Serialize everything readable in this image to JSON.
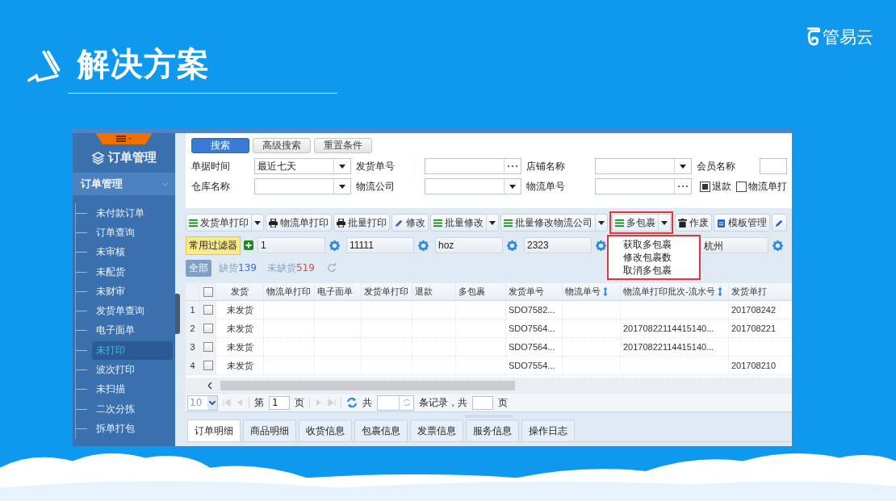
{
  "slide": {
    "title": "解决方案",
    "logo": "管易云"
  },
  "sidebar": {
    "title": "订单管理",
    "section": {
      "label": "订单管理",
      "expanded": true
    },
    "items": [
      {
        "label": "未付款订单",
        "selected": false
      },
      {
        "label": "订单查询",
        "selected": false
      },
      {
        "label": "未审核",
        "selected": false
      },
      {
        "label": "未配货",
        "selected": false
      },
      {
        "label": "未财审",
        "selected": false
      },
      {
        "label": "发货单查询",
        "selected": false
      },
      {
        "label": "电子面单",
        "selected": false
      },
      {
        "label": "未打印",
        "selected": true
      },
      {
        "label": "波次打印",
        "selected": false
      },
      {
        "label": "未扫描",
        "selected": false
      },
      {
        "label": "二次分拣",
        "selected": false
      },
      {
        "label": "拆单打包",
        "selected": false
      }
    ]
  },
  "search": {
    "buttons": [
      {
        "label": "搜索",
        "selected": true
      },
      {
        "label": "高级搜索",
        "selected": false
      },
      {
        "label": "重置条件",
        "selected": false
      }
    ],
    "fields": [
      {
        "label": "单据时间",
        "kind": "select",
        "value": "最近七天"
      },
      {
        "label": "发货单号",
        "kind": "picker"
      },
      {
        "label": "店铺名称",
        "kind": "select"
      },
      {
        "label": "会员名称",
        "kind": "text"
      },
      {
        "label": "仓库名称",
        "kind": "select"
      },
      {
        "label": "物流公司",
        "kind": "select"
      },
      {
        "label": "物流单号",
        "kind": "picker"
      }
    ],
    "checkboxes": [
      {
        "label": "退款",
        "checked": true
      },
      {
        "label": "物流单打",
        "checked": false
      }
    ]
  },
  "toolbar": {
    "buttons": [
      {
        "label": "发货单打印",
        "kind": "list",
        "split": true,
        "open": false
      },
      {
        "label": "物流单打印",
        "kind": "printer",
        "split": false,
        "open": false
      },
      {
        "label": "批量打印",
        "kind": "printer",
        "split": false,
        "open": false
      },
      {
        "label": "修改",
        "kind": "pencil",
        "split": false,
        "open": false
      },
      {
        "label": "批量修改",
        "kind": "list",
        "split": true,
        "open": false
      },
      {
        "label": "批量修改物流公司",
        "kind": "list",
        "split": true,
        "open": false
      },
      {
        "label": "多包裹",
        "kind": "list",
        "split": true,
        "open": true
      },
      {
        "label": "作废",
        "kind": "trash",
        "split": false,
        "open": false
      },
      {
        "label": "模板管理",
        "kind": "clipboard",
        "split": false,
        "open": false
      },
      {
        "kind": "pencil",
        "split": false,
        "open": false
      }
    ]
  },
  "menu": {
    "items": [
      "获取多包裹",
      "修改包裹数",
      "取消多包裹"
    ]
  },
  "filters": {
    "label": "常用过滤器",
    "inputs": [
      "1",
      "11111",
      "hoz",
      "2323",
      "杭州"
    ]
  },
  "status_tabs": [
    {
      "label": "全部",
      "selected": true
    },
    {
      "label": "缺货",
      "count": "139",
      "color": "#3a6fd0",
      "selected": false
    },
    {
      "label": "未缺货",
      "count": "519",
      "color": "#c0584a",
      "selected": false
    }
  ],
  "table": {
    "all_checked": false,
    "columns": [
      {
        "label": "发货"
      },
      {
        "label": "物流单打印"
      },
      {
        "label": "电子面单"
      },
      {
        "label": "发货单打印"
      },
      {
        "label": "退款"
      },
      {
        "label": "多包裹"
      },
      {
        "label": "发货单号"
      },
      {
        "label": "物流单号",
        "sortable": true
      },
      {
        "label": "物流单打印批次-流水号",
        "sortable": true
      },
      {
        "label": "发货单打"
      }
    ],
    "rows": [
      {
        "number": "1",
        "checked": false,
        "cells": [
          "未发货",
          "",
          "",
          "",
          "",
          "",
          "SDO7582...",
          "",
          "",
          "201708242"
        ]
      },
      {
        "number": "2",
        "checked": false,
        "cells": [
          "未发货",
          "",
          "",
          "",
          "",
          "",
          "SDO7564...",
          "",
          "20170822114415140...",
          "201708221"
        ]
      },
      {
        "number": "3",
        "checked": false,
        "cells": [
          "未发货",
          "",
          "",
          "",
          "",
          "",
          "SDO7564...",
          "",
          "20170822114415140...",
          ""
        ]
      },
      {
        "number": "4",
        "checked": false,
        "cells": [
          "未发货",
          "",
          "",
          "",
          "",
          "",
          "SDO7554...",
          "",
          "",
          "201708210"
        ]
      }
    ]
  },
  "pager": {
    "size": "10",
    "before_page": "第",
    "page": "1",
    "after_page": "页",
    "total_label": "共",
    "records_label": "条记录，共",
    "pages_label": "页"
  },
  "bottom_tabs": [
    {
      "label": "订单明细",
      "selected": true
    },
    {
      "label": "商品明细",
      "selected": false
    },
    {
      "label": "收货信息",
      "selected": false
    },
    {
      "label": "包裹信息",
      "selected": false
    },
    {
      "label": "发票信息",
      "selected": false
    },
    {
      "label": "服务信息",
      "selected": false
    },
    {
      "label": "操作日志",
      "selected": false
    }
  ]
}
